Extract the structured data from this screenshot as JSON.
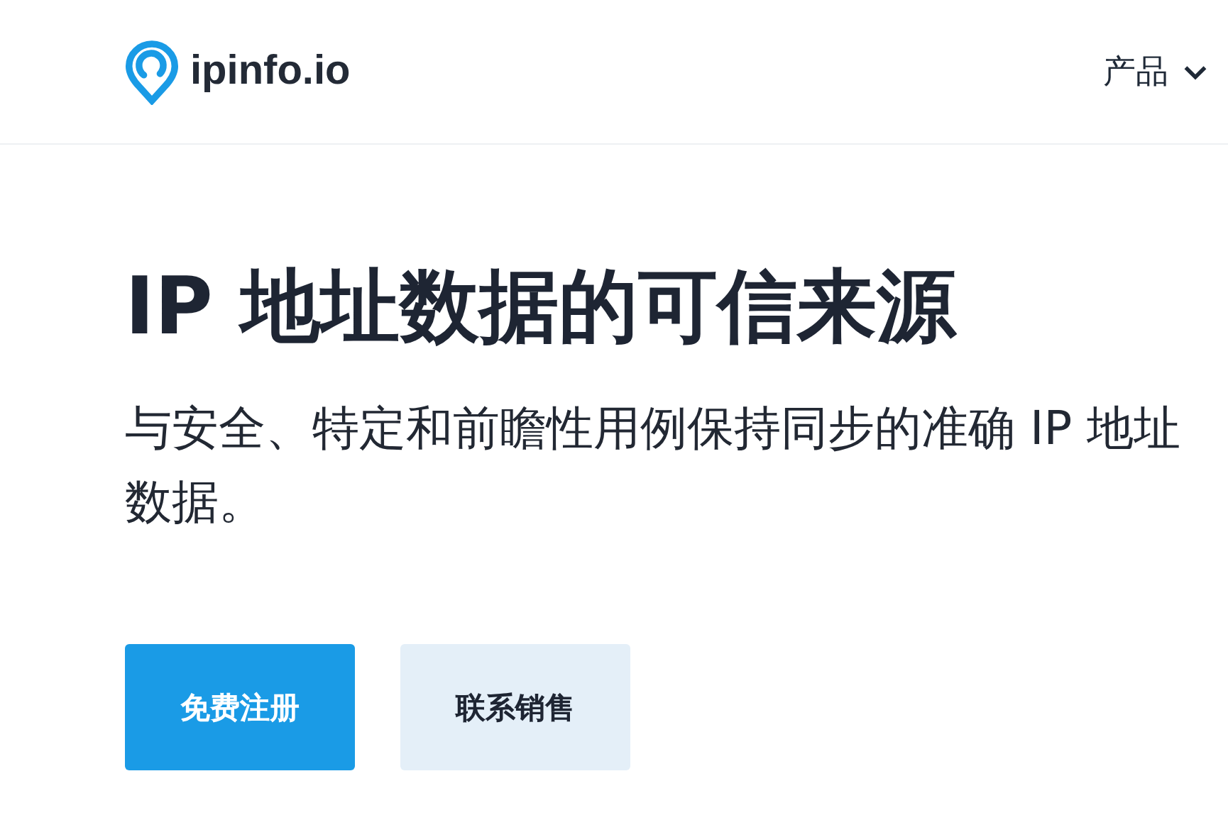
{
  "header": {
    "logo_text": "ipinfo.io",
    "nav": [
      {
        "label": "产品",
        "expanded": false
      }
    ]
  },
  "hero": {
    "title": "IP 地址数据的可信来源",
    "subtitle": "与安全、特定和前瞻性用例保持同步的准确 IP 地址数据。",
    "buttons": [
      {
        "label": "免费注册",
        "kind": "primary"
      },
      {
        "label": "联系销售",
        "kind": "secondary"
      }
    ]
  }
}
